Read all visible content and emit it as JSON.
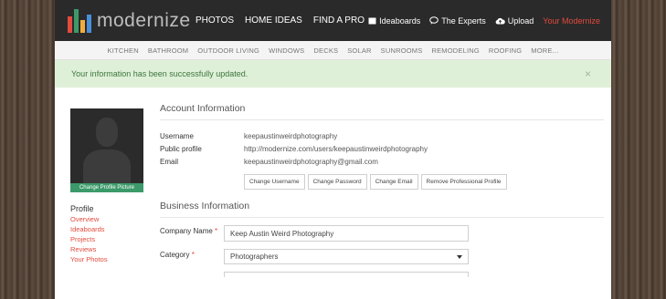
{
  "brand": {
    "name": "modernize",
    "bar_colors": [
      "#e34b3d",
      "#3c9a6a",
      "#f0ad3e",
      "#4a8fd9"
    ]
  },
  "main_nav": [
    "PHOTOS",
    "HOME IDEAS",
    "FIND A PRO"
  ],
  "user_nav": {
    "ideaboards": "Ideaboards",
    "experts": "The Experts",
    "upload": "Upload",
    "your_modernize": "Your Modernize"
  },
  "sub_nav": [
    "KITCHEN",
    "BATHROOM",
    "OUTDOOR LIVING",
    "WINDOWS",
    "DECKS",
    "SOLAR",
    "SUNROOMS",
    "REMODELING",
    "ROOFING",
    "MORE..."
  ],
  "alert": {
    "message": "Your information has been successfully updated.",
    "close": "×"
  },
  "sidebar": {
    "change_picture": "Change Profile Picture",
    "heading": "Profile",
    "links": [
      "Overview",
      "Ideaboards",
      "Projects",
      "Reviews",
      "Your Photos"
    ]
  },
  "account": {
    "title": "Account Information",
    "rows": [
      {
        "label": "Username",
        "value": "keepaustinweirdphotography"
      },
      {
        "label": "Public profile",
        "value": "http://modernize.com/users/keepaustinweirdphotography"
      },
      {
        "label": "Email",
        "value": "keepaustinweirdphotography@gmail.com"
      }
    ],
    "buttons": [
      "Change Username",
      "Change Password",
      "Change Email",
      "Remove Professional Profile"
    ]
  },
  "business": {
    "title": "Business Information",
    "company_label": "Company Name",
    "company_value": "Keep Austin Weird Photography",
    "category_label": "Category",
    "category_value": "Photographers",
    "required_mark": "*"
  },
  "colors": {
    "accent": "#e34b3d",
    "green": "#3c9a6a",
    "topbar": "#2a2a2a",
    "alert_bg": "#dff0d8"
  }
}
